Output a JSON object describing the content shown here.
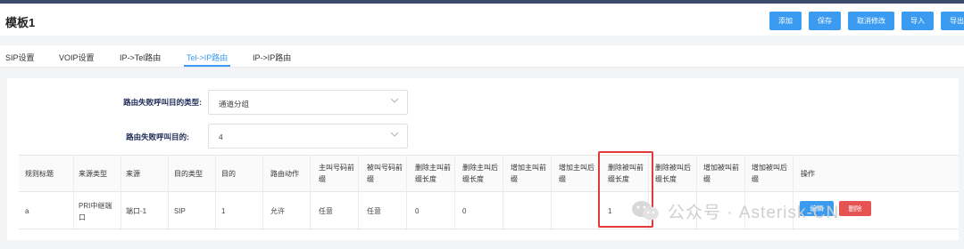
{
  "header": {
    "title": "模板1",
    "buttons": [
      "添加",
      "保存",
      "取消修改",
      "导入",
      "导出"
    ]
  },
  "tabs": [
    "SIP设置",
    "VOIP设置",
    "IP->Tel路由",
    "Tel->IP路由",
    "IP->IP路由"
  ],
  "active_tab": "Tel->IP路由",
  "form": {
    "fail_type_label": "路由失败呼叫目的类型:",
    "fail_type_value": "通道分组",
    "fail_dest_label": "路由失败呼叫目的:",
    "fail_dest_value": "4"
  },
  "table": {
    "columns": [
      [
        "规则标题"
      ],
      [
        "来源类型"
      ],
      [
        "来源"
      ],
      [
        "目的类型"
      ],
      [
        "目的"
      ],
      [
        "路由动作"
      ],
      [
        "主叫号码前",
        "缀"
      ],
      [
        "被叫号码前",
        "缀"
      ],
      [
        "删除主叫前",
        "缀长度"
      ],
      [
        "删除主叫后",
        "缀长度"
      ],
      [
        "增加主叫前",
        "缀"
      ],
      [
        "增加主叫后",
        "缀"
      ],
      [
        "删除被叫前",
        "缀长度"
      ],
      [
        "删除被叫后",
        "缀长度"
      ],
      [
        "增加被叫前",
        "缀"
      ],
      [
        "增加被叫后",
        "缀"
      ],
      [
        "操作"
      ]
    ],
    "row": {
      "rule_title": "a",
      "source_type": [
        "PRI中继端",
        "口"
      ],
      "source": "端口-1",
      "dest_type": "SIP",
      "dest": "1",
      "action": "允许",
      "caller_prefix": "任意",
      "callee_prefix": "任意",
      "del_caller_prefix_len": "0",
      "del_caller_suffix_len": "0",
      "del_callee_prefix_len": "1",
      "edit_label": "编辑",
      "delete_label": "删除"
    }
  },
  "watermark": "公众号 · Asterisk-CN",
  "colors": {
    "accent": "#3a9bf0",
    "danger": "#e55353",
    "highlight": "#e23a3a",
    "topbar": "#3a4a6b"
  }
}
